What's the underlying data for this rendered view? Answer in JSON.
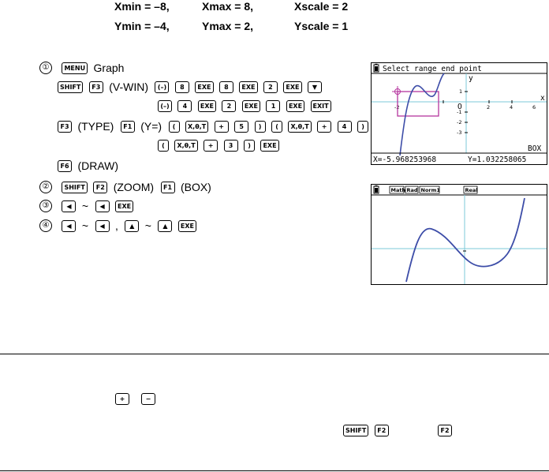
{
  "range": {
    "xmin": "Xmin = –8,",
    "xmax": "Xmax = 8,",
    "xscale": "Xscale = 2",
    "ymin": "Ymin = –4,",
    "ymax": "Ymax = 2,",
    "yscale": "Yscale = 1"
  },
  "steps": {
    "s1": "①",
    "s2": "②",
    "s3": "③",
    "s4": "④",
    "graph": "Graph",
    "vwin": "(V-WIN)",
    "type": "(TYPE)",
    "yeq": "(Y=)",
    "draw": "(DRAW)",
    "zoom": "(ZOOM)",
    "box": "(BOX)",
    "tilde": "~",
    "comma": ","
  },
  "keys": {
    "menu": "MENU",
    "shift": "SHIFT",
    "f1": "F1",
    "f2": "F2",
    "f3": "F3",
    "f6": "F6",
    "neg": "(–)",
    "exe": "EXE",
    "exit": "EXIT",
    "xtheta": "X,θ,T",
    "plus": "+",
    "minus": "−",
    "lparen": "(",
    "rparen": ")",
    "n8": "8",
    "n2": "2",
    "n4": "4",
    "n1": "1",
    "n5": "5",
    "n3": "3",
    "down": "▼",
    "left": "◀",
    "up": "▲"
  },
  "screen1": {
    "header": "Select range end point",
    "ylabel": "y",
    "xlabel": "x",
    "origin": "O",
    "xticks": [
      "-2",
      "2",
      "4",
      "6"
    ],
    "yticks": [
      "1",
      "-1",
      "-2",
      "-3"
    ],
    "mode": "BOX",
    "xreadout": "X=-5.968253968",
    "yreadout": "Y=1.032258065"
  },
  "screen2": {
    "status": [
      "Math",
      "Rad",
      "Norm1",
      "Real"
    ]
  }
}
